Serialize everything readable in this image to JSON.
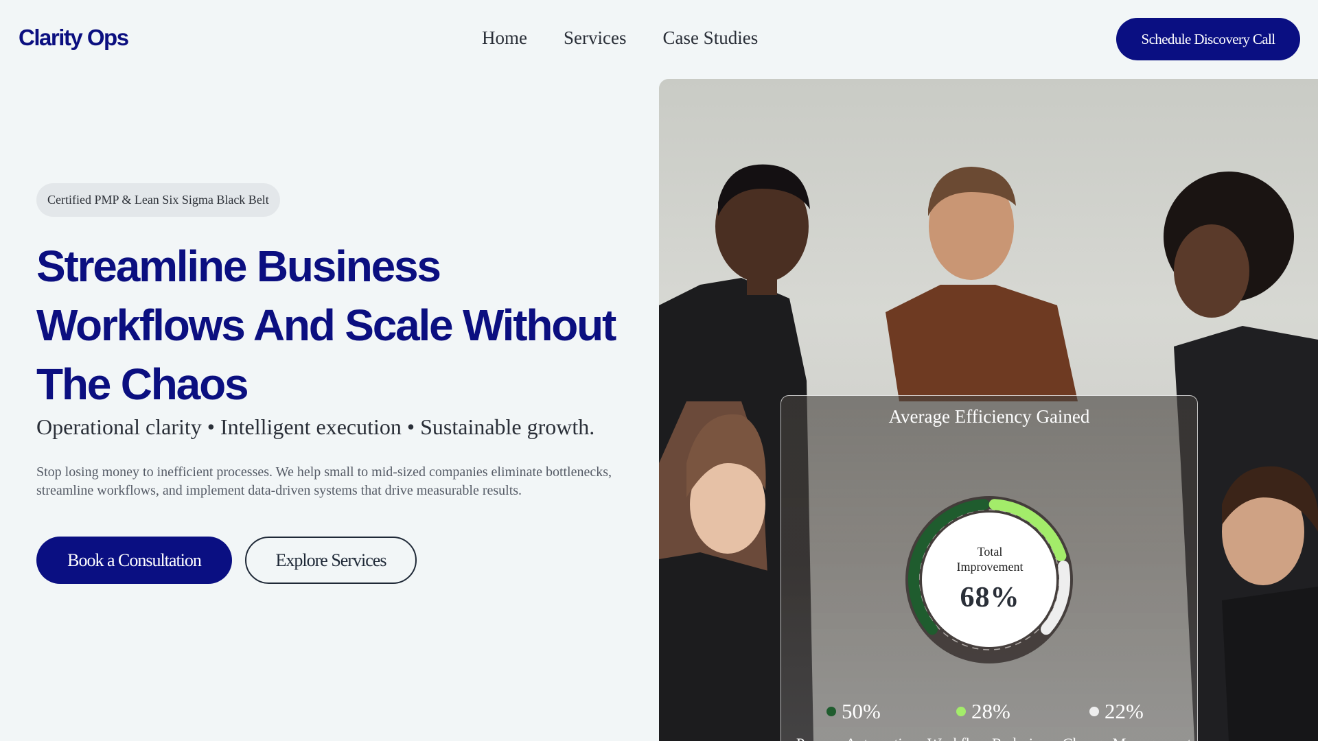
{
  "header": {
    "logo": "Clarity Ops",
    "nav": [
      "Home",
      "Services",
      "Case Studies"
    ],
    "cta": "Schedule Discovery Call"
  },
  "hero": {
    "badge": "Certified PMP & Lean Six Sigma Black Belt",
    "title_lines": [
      "Streamline Business",
      "Workflows And Scale Without",
      "The Chaos"
    ],
    "tagline": "Operational clarity • Intelligent execution • Sustainable growth.",
    "description": "Stop losing money to inefficient processes. We help small to mid-sized companies eliminate bottlenecks, streamline workflows, and implement data-driven systems that drive measurable results.",
    "primary_button": "Book a Consultation",
    "secondary_button": "Explore Services"
  },
  "efficiency_card": {
    "title": "Average Efficiency Gained",
    "center_label": "Total Improvement",
    "center_value": "68%"
  },
  "chart_data": {
    "type": "pie",
    "title": "Average Efficiency Gained",
    "center_label": "Total Improvement",
    "center_value": "68%",
    "series": [
      {
        "name": "Process Automation",
        "value": 50,
        "label": "50%",
        "color": "#1f5c2e"
      },
      {
        "name": "Workflow Redesign",
        "value": 28,
        "label": "28%",
        "color": "#a3ec6a"
      },
      {
        "name": "Change Management",
        "value": 22,
        "label": "22%",
        "color": "#eeeeee"
      }
    ],
    "legend": "bottom"
  },
  "colors": {
    "brand": "#0b0f80",
    "background": "#f2f6f7"
  }
}
